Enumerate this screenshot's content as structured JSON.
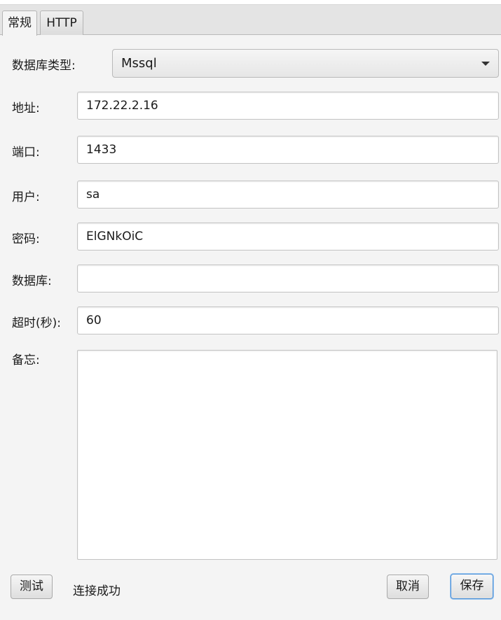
{
  "tabs": [
    {
      "label": "常规",
      "active": true
    },
    {
      "label": "HTTP",
      "active": false
    }
  ],
  "form": {
    "db_type_label": "数据库类型:",
    "db_type_value": "Mssql",
    "address_label": "地址:",
    "address_value": "172.22.2.16",
    "port_label": "端口:",
    "port_value": "1433",
    "user_label": "用户:",
    "user_value": "sa",
    "password_label": "密码:",
    "password_value": "ElGNkOiC",
    "database_label": "数据库:",
    "database_value": "",
    "timeout_label": "超时(秒):",
    "timeout_value": "60",
    "memo_label": "备忘:",
    "memo_value": ""
  },
  "footer": {
    "test_label": "测试",
    "status_text": "连接成功",
    "cancel_label": "取消",
    "save_label": "保存"
  },
  "colors": {
    "background": "#f4f4f4",
    "focus_border": "#4a90d9"
  }
}
